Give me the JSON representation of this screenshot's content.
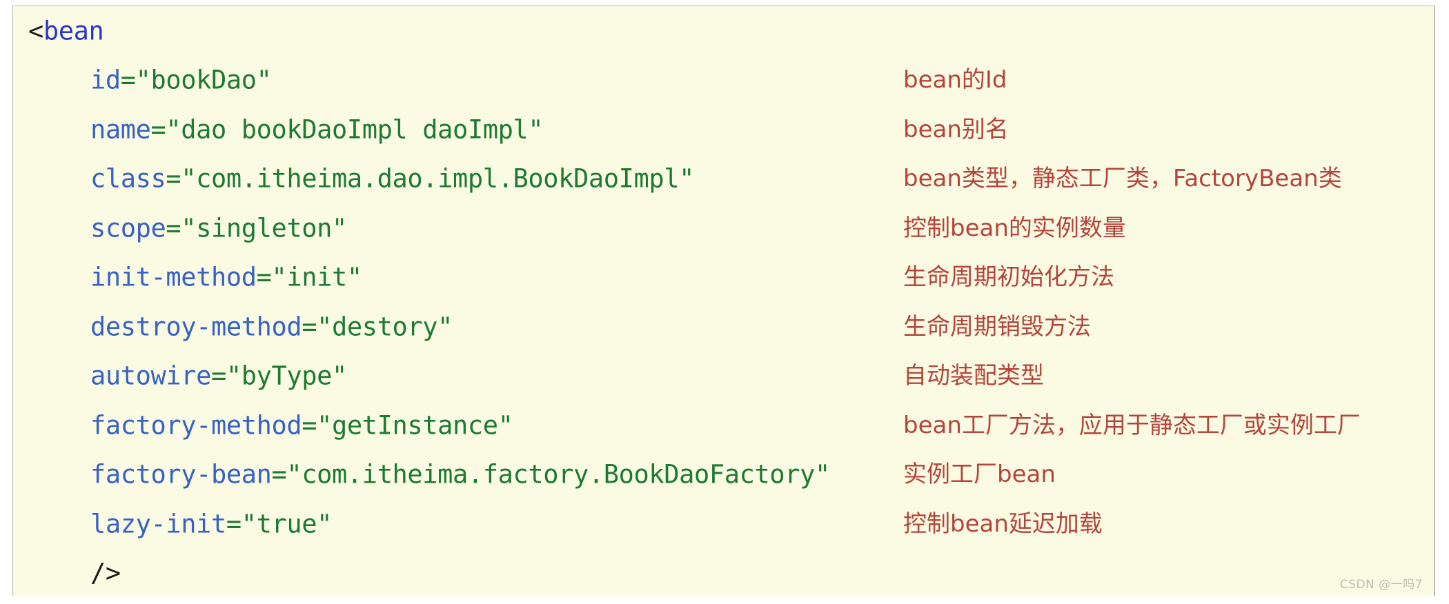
{
  "panel": {
    "background_color": "#fbfbe4",
    "border_color": "#b9b9b0",
    "language": "xml"
  },
  "colors": {
    "tag": "#2a36c9",
    "attribute": "#3761c4",
    "value": "#1d7a33",
    "punctuation": "#1b1b1b",
    "annotation": "#b4453c",
    "watermark": "#bdbdb2"
  },
  "code": {
    "open_tag_bracket": "<",
    "open_tag_name": "bean",
    "close_tag": "/>",
    "lines": [
      {
        "indent": false,
        "kind": "open-tag",
        "bracket": "<",
        "tag": "bean",
        "attr": "",
        "eq": "",
        "value": "",
        "annotation": ""
      },
      {
        "indent": true,
        "kind": "attribute",
        "bracket": "",
        "tag": "",
        "attr": "id",
        "eq": "=",
        "value": "\"bookDao\"",
        "annotation": "bean的Id"
      },
      {
        "indent": true,
        "kind": "attribute",
        "bracket": "",
        "tag": "",
        "attr": "name",
        "eq": "=",
        "value": "\"dao bookDaoImpl daoImpl\"",
        "annotation": "bean别名"
      },
      {
        "indent": true,
        "kind": "attribute",
        "bracket": "",
        "tag": "",
        "attr": "class",
        "eq": "=",
        "value": "\"com.itheima.dao.impl.BookDaoImpl\"",
        "annotation": "bean类型，静态工厂类，FactoryBean类"
      },
      {
        "indent": true,
        "kind": "attribute",
        "bracket": "",
        "tag": "",
        "attr": "scope",
        "eq": "=",
        "value": "\"singleton\"",
        "annotation": "控制bean的实例数量"
      },
      {
        "indent": true,
        "kind": "attribute",
        "bracket": "",
        "tag": "",
        "attr": "init-method",
        "eq": "=",
        "value": "\"init\"",
        "annotation": "生命周期初始化方法"
      },
      {
        "indent": true,
        "kind": "attribute",
        "bracket": "",
        "tag": "",
        "attr": "destroy-method",
        "eq": "=",
        "value": "\"destory\"",
        "annotation": "生命周期销毁方法"
      },
      {
        "indent": true,
        "kind": "attribute",
        "bracket": "",
        "tag": "",
        "attr": "autowire",
        "eq": "=",
        "value": "\"byType\"",
        "annotation": "自动装配类型"
      },
      {
        "indent": true,
        "kind": "attribute",
        "bracket": "",
        "tag": "",
        "attr": "factory-method",
        "eq": "=",
        "value": "\"getInstance\"",
        "annotation": "bean工厂方法，应用于静态工厂或实例工厂"
      },
      {
        "indent": true,
        "kind": "attribute",
        "bracket": "",
        "tag": "",
        "attr": "factory-bean",
        "eq": "=",
        "value": "\"com.itheima.factory.BookDaoFactory\"",
        "annotation": "实例工厂bean"
      },
      {
        "indent": true,
        "kind": "attribute",
        "bracket": "",
        "tag": "",
        "attr": "lazy-init",
        "eq": "=",
        "value": "\"true\"",
        "annotation": "控制bean延迟加载"
      },
      {
        "indent": true,
        "kind": "close-tag",
        "bracket": "",
        "tag": "",
        "attr": "",
        "eq": "",
        "value": "",
        "close": "/>",
        "annotation": ""
      }
    ]
  },
  "watermark": {
    "text": "CSDN @一吗7"
  }
}
